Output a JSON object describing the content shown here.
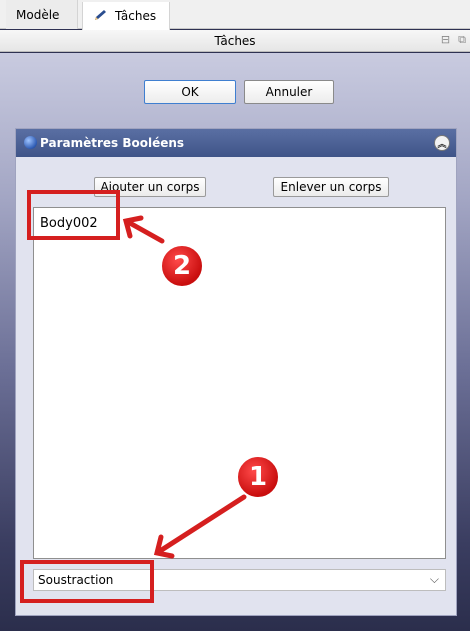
{
  "tabs": [
    {
      "label": "Modèle"
    },
    {
      "label": "Tâches"
    }
  ],
  "panel_title": "Tâches",
  "dialog": {
    "ok_label": "OK",
    "cancel_label": "Annuler"
  },
  "boolean_params": {
    "title": "Paramètres Booléens",
    "add_body_label": "Ajouter un corps",
    "remove_body_label": "Enlever un corps",
    "bodies": [
      "Body002"
    ],
    "operation": "Soustraction"
  },
  "annotations": {
    "badge_1": "1",
    "badge_2": "2",
    "color": "#d51f1f"
  }
}
